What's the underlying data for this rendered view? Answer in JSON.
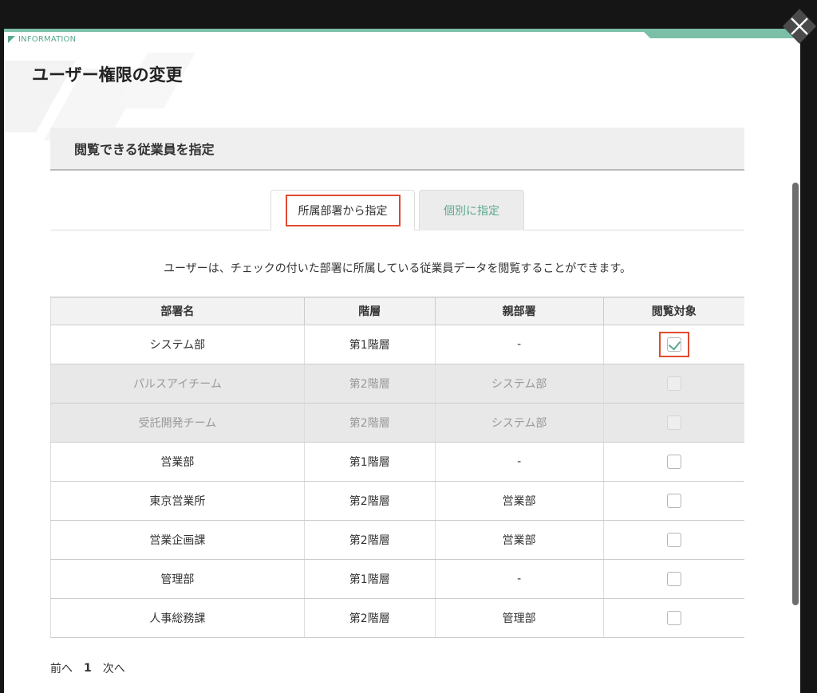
{
  "info_label": "INFORMATION",
  "title": "ユーザー権限の変更",
  "section_title": "閲覧できる従業員を指定",
  "tabs": [
    {
      "label": "所属部署から指定",
      "active": true
    },
    {
      "label": "個別に指定",
      "active": false
    }
  ],
  "description": "ユーザーは、チェックの付いた部署に所属している従業員データを閲覧することができます。",
  "table": {
    "headers": [
      "部署名",
      "階層",
      "親部署",
      "閲覧対象"
    ],
    "rows": [
      {
        "name": "システム部",
        "level": "第1階層",
        "parent": "-",
        "checked": true,
        "disabled": false
      },
      {
        "name": "パルスアイチーム",
        "level": "第2階層",
        "parent": "システム部",
        "checked": false,
        "disabled": true
      },
      {
        "name": "受託開発チーム",
        "level": "第2階層",
        "parent": "システム部",
        "checked": false,
        "disabled": true
      },
      {
        "name": "営業部",
        "level": "第1階層",
        "parent": "-",
        "checked": false,
        "disabled": false
      },
      {
        "name": "東京営業所",
        "level": "第2階層",
        "parent": "営業部",
        "checked": false,
        "disabled": false
      },
      {
        "name": "営業企画課",
        "level": "第2階層",
        "parent": "営業部",
        "checked": false,
        "disabled": false
      },
      {
        "name": "管理部",
        "level": "第1階層",
        "parent": "-",
        "checked": false,
        "disabled": false
      },
      {
        "name": "人事総務課",
        "level": "第2階層",
        "parent": "管理部",
        "checked": false,
        "disabled": false
      }
    ]
  },
  "pagination": {
    "prev": "前へ",
    "current": "1",
    "next": "次へ"
  },
  "colors": {
    "accent": "#5aa88b",
    "highlight": "#e04a2f"
  },
  "icons": {
    "close": "close-icon",
    "check": "check-icon"
  }
}
